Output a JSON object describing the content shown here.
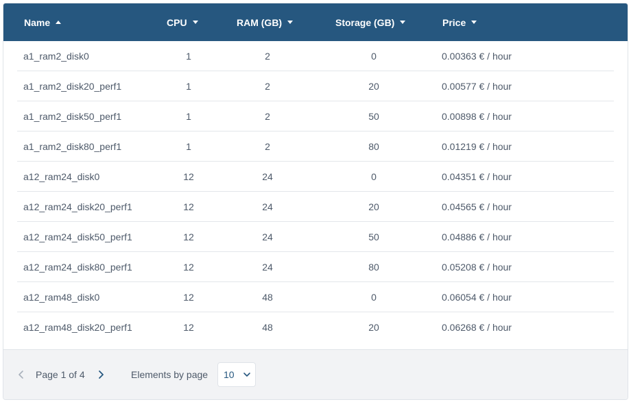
{
  "table": {
    "columns": [
      {
        "key": "name",
        "label": "Name",
        "sort": "asc"
      },
      {
        "key": "cpu",
        "label": "CPU",
        "sort": "desc"
      },
      {
        "key": "ram",
        "label": "RAM (GB)",
        "sort": "desc"
      },
      {
        "key": "storage",
        "label": "Storage (GB)",
        "sort": "desc"
      },
      {
        "key": "price",
        "label": "Price",
        "sort": "desc"
      }
    ],
    "rows": [
      {
        "name": "a1_ram2_disk0",
        "cpu": "1",
        "ram": "2",
        "storage": "0",
        "price": "0.00363 € / hour"
      },
      {
        "name": "a1_ram2_disk20_perf1",
        "cpu": "1",
        "ram": "2",
        "storage": "20",
        "price": "0.00577 € / hour"
      },
      {
        "name": "a1_ram2_disk50_perf1",
        "cpu": "1",
        "ram": "2",
        "storage": "50",
        "price": "0.00898 € / hour"
      },
      {
        "name": "a1_ram2_disk80_perf1",
        "cpu": "1",
        "ram": "2",
        "storage": "80",
        "price": "0.01219 € / hour"
      },
      {
        "name": "a12_ram24_disk0",
        "cpu": "12",
        "ram": "24",
        "storage": "0",
        "price": "0.04351 € / hour"
      },
      {
        "name": "a12_ram24_disk20_perf1",
        "cpu": "12",
        "ram": "24",
        "storage": "20",
        "price": "0.04565 € / hour"
      },
      {
        "name": "a12_ram24_disk50_perf1",
        "cpu": "12",
        "ram": "24",
        "storage": "50",
        "price": "0.04886 € / hour"
      },
      {
        "name": "a12_ram24_disk80_perf1",
        "cpu": "12",
        "ram": "24",
        "storage": "80",
        "price": "0.05208 € / hour"
      },
      {
        "name": "a12_ram48_disk0",
        "cpu": "12",
        "ram": "48",
        "storage": "0",
        "price": "0.06054 € / hour"
      },
      {
        "name": "a12_ram48_disk20_perf1",
        "cpu": "12",
        "ram": "48",
        "storage": "20",
        "price": "0.06268 € / hour"
      }
    ]
  },
  "pagination": {
    "page_label": "Page 1 of 4",
    "elements_label": "Elements by page",
    "elements_value": "10"
  },
  "colors": {
    "header_bg": "#26577f",
    "footer_bg": "#f2f3f5",
    "text": "#4d5969"
  },
  "icons": {
    "sort_asc": "caret-up-icon",
    "sort_desc": "caret-down-icon",
    "prev": "chevron-left-icon",
    "next": "chevron-right-icon",
    "select": "chevron-down-icon"
  }
}
